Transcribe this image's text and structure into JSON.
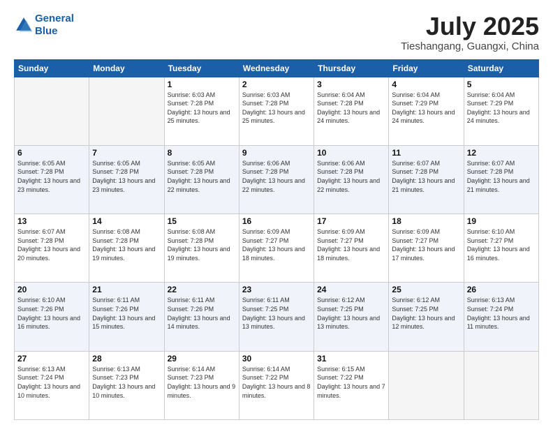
{
  "header": {
    "logo_line1": "General",
    "logo_line2": "Blue",
    "month": "July 2025",
    "location": "Tieshangang, Guangxi, China"
  },
  "weekdays": [
    "Sunday",
    "Monday",
    "Tuesday",
    "Wednesday",
    "Thursday",
    "Friday",
    "Saturday"
  ],
  "weeks": [
    [
      {
        "day": "",
        "empty": true
      },
      {
        "day": "",
        "empty": true
      },
      {
        "day": "1",
        "sunrise": "6:03 AM",
        "sunset": "7:28 PM",
        "daylight": "13 hours and 25 minutes."
      },
      {
        "day": "2",
        "sunrise": "6:03 AM",
        "sunset": "7:28 PM",
        "daylight": "13 hours and 25 minutes."
      },
      {
        "day": "3",
        "sunrise": "6:04 AM",
        "sunset": "7:28 PM",
        "daylight": "13 hours and 24 minutes."
      },
      {
        "day": "4",
        "sunrise": "6:04 AM",
        "sunset": "7:29 PM",
        "daylight": "13 hours and 24 minutes."
      },
      {
        "day": "5",
        "sunrise": "6:04 AM",
        "sunset": "7:29 PM",
        "daylight": "13 hours and 24 minutes."
      }
    ],
    [
      {
        "day": "6",
        "sunrise": "6:05 AM",
        "sunset": "7:28 PM",
        "daylight": "13 hours and 23 minutes."
      },
      {
        "day": "7",
        "sunrise": "6:05 AM",
        "sunset": "7:28 PM",
        "daylight": "13 hours and 23 minutes."
      },
      {
        "day": "8",
        "sunrise": "6:05 AM",
        "sunset": "7:28 PM",
        "daylight": "13 hours and 22 minutes."
      },
      {
        "day": "9",
        "sunrise": "6:06 AM",
        "sunset": "7:28 PM",
        "daylight": "13 hours and 22 minutes."
      },
      {
        "day": "10",
        "sunrise": "6:06 AM",
        "sunset": "7:28 PM",
        "daylight": "13 hours and 22 minutes."
      },
      {
        "day": "11",
        "sunrise": "6:07 AM",
        "sunset": "7:28 PM",
        "daylight": "13 hours and 21 minutes."
      },
      {
        "day": "12",
        "sunrise": "6:07 AM",
        "sunset": "7:28 PM",
        "daylight": "13 hours and 21 minutes."
      }
    ],
    [
      {
        "day": "13",
        "sunrise": "6:07 AM",
        "sunset": "7:28 PM",
        "daylight": "13 hours and 20 minutes."
      },
      {
        "day": "14",
        "sunrise": "6:08 AM",
        "sunset": "7:28 PM",
        "daylight": "13 hours and 19 minutes."
      },
      {
        "day": "15",
        "sunrise": "6:08 AM",
        "sunset": "7:28 PM",
        "daylight": "13 hours and 19 minutes."
      },
      {
        "day": "16",
        "sunrise": "6:09 AM",
        "sunset": "7:27 PM",
        "daylight": "13 hours and 18 minutes."
      },
      {
        "day": "17",
        "sunrise": "6:09 AM",
        "sunset": "7:27 PM",
        "daylight": "13 hours and 18 minutes."
      },
      {
        "day": "18",
        "sunrise": "6:09 AM",
        "sunset": "7:27 PM",
        "daylight": "13 hours and 17 minutes."
      },
      {
        "day": "19",
        "sunrise": "6:10 AM",
        "sunset": "7:27 PM",
        "daylight": "13 hours and 16 minutes."
      }
    ],
    [
      {
        "day": "20",
        "sunrise": "6:10 AM",
        "sunset": "7:26 PM",
        "daylight": "13 hours and 16 minutes."
      },
      {
        "day": "21",
        "sunrise": "6:11 AM",
        "sunset": "7:26 PM",
        "daylight": "13 hours and 15 minutes."
      },
      {
        "day": "22",
        "sunrise": "6:11 AM",
        "sunset": "7:26 PM",
        "daylight": "13 hours and 14 minutes."
      },
      {
        "day": "23",
        "sunrise": "6:11 AM",
        "sunset": "7:25 PM",
        "daylight": "13 hours and 13 minutes."
      },
      {
        "day": "24",
        "sunrise": "6:12 AM",
        "sunset": "7:25 PM",
        "daylight": "13 hours and 13 minutes."
      },
      {
        "day": "25",
        "sunrise": "6:12 AM",
        "sunset": "7:25 PM",
        "daylight": "13 hours and 12 minutes."
      },
      {
        "day": "26",
        "sunrise": "6:13 AM",
        "sunset": "7:24 PM",
        "daylight": "13 hours and 11 minutes."
      }
    ],
    [
      {
        "day": "27",
        "sunrise": "6:13 AM",
        "sunset": "7:24 PM",
        "daylight": "13 hours and 10 minutes."
      },
      {
        "day": "28",
        "sunrise": "6:13 AM",
        "sunset": "7:23 PM",
        "daylight": "13 hours and 10 minutes."
      },
      {
        "day": "29",
        "sunrise": "6:14 AM",
        "sunset": "7:23 PM",
        "daylight": "13 hours and 9 minutes."
      },
      {
        "day": "30",
        "sunrise": "6:14 AM",
        "sunset": "7:22 PM",
        "daylight": "13 hours and 8 minutes."
      },
      {
        "day": "31",
        "sunrise": "6:15 AM",
        "sunset": "7:22 PM",
        "daylight": "13 hours and 7 minutes."
      },
      {
        "day": "",
        "empty": true
      },
      {
        "day": "",
        "empty": true
      }
    ]
  ]
}
